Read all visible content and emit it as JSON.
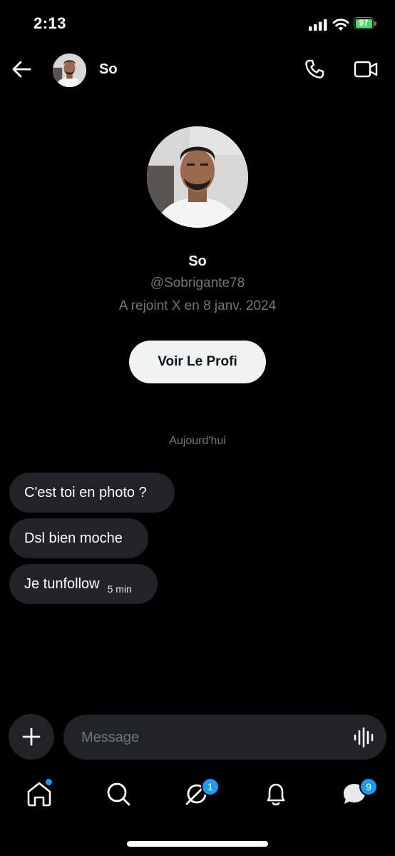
{
  "status_bar": {
    "time": "2:13",
    "battery": "97"
  },
  "header": {
    "name": "So"
  },
  "profile": {
    "name": "So",
    "handle": "@Sobrigante78",
    "joined": "A rejoint X en 8 janv. 2024",
    "button_label": "Voir Le Profi"
  },
  "conversation": {
    "date_separator": "Aujourd'hui",
    "messages": [
      {
        "text": "C'est toi en photo ?"
      },
      {
        "text": "Dsl bien moche"
      },
      {
        "text": "Je tunfollow",
        "time": "5 min"
      }
    ]
  },
  "composer": {
    "placeholder": "Message"
  },
  "bottom_nav": {
    "grok_badge": "1",
    "messages_badge": "9"
  },
  "colors": {
    "background": "#000000",
    "bubble": "#202327",
    "secondary_text": "#71767b",
    "accent": "#1d9bf0",
    "battery": "#4cd964"
  },
  "icons": [
    "back-arrow-icon",
    "phone-icon",
    "video-camera-icon",
    "plus-icon",
    "voice-wave-icon",
    "home-icon",
    "search-icon",
    "grok-icon",
    "bell-icon",
    "messages-icon",
    "signal-icon",
    "wifi-icon",
    "battery-icon"
  ]
}
